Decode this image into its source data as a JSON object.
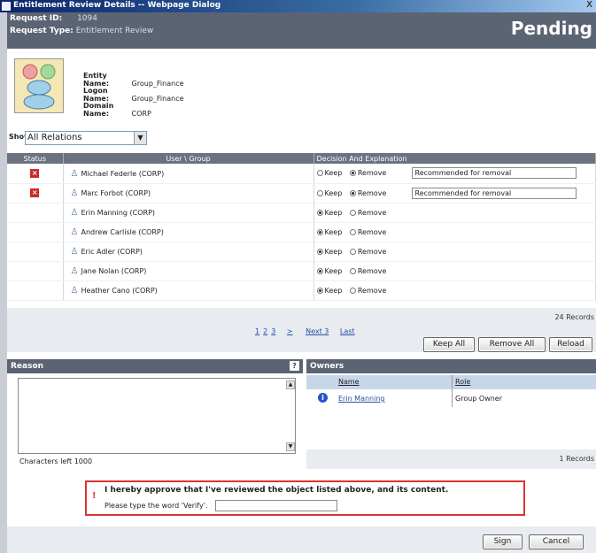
{
  "window": {
    "title": "Entitlement Review Details -- Webpage Dialog",
    "close": "X"
  },
  "header": {
    "request_id_label": "Request ID:",
    "request_id": "1094",
    "request_type_label": "Request Type:",
    "request_type": "Entitlement Review",
    "status": "Pending"
  },
  "entity": {
    "entity_name_label": "Entity Name:",
    "entity_name": "Group_Finance",
    "logon_name_label": "Logon Name:",
    "logon_name": "Group_Finance",
    "domain_name_label": "Domain Name:",
    "domain_name": "CORP"
  },
  "show": {
    "label": "Show:",
    "value": "All Relations"
  },
  "grid": {
    "columns": [
      "Status",
      "User \\ Group",
      "Decision And Explanation"
    ],
    "keep_label": "Keep",
    "remove_label": "Remove",
    "rows": [
      {
        "user": "Michael Federle (CORP)",
        "removed": true,
        "explanation": "Recommended for removal"
      },
      {
        "user": "Marc Forbot (CORP)",
        "removed": true,
        "explanation": "Recommended for removal"
      },
      {
        "user": "Erin Manning (CORP)",
        "removed": false,
        "explanation": ""
      },
      {
        "user": "Andrew Carlisle (CORP)",
        "removed": false,
        "explanation": ""
      },
      {
        "user": "Eric Adler (CORP)",
        "removed": false,
        "explanation": ""
      },
      {
        "user": "Jane Nolan (CORP)",
        "removed": false,
        "explanation": ""
      },
      {
        "user": "Heather Cano (CORP)",
        "removed": false,
        "explanation": ""
      }
    ],
    "records": "24 Records",
    "pager": {
      "p1": "1",
      "p2": "2",
      "p3": "3",
      "gt": ">",
      "next": "Next 3",
      "last": "Last"
    }
  },
  "buttons": {
    "keep_all": "Keep All",
    "remove_all": "Remove All",
    "reload": "Reload",
    "sign": "Sign",
    "cancel": "Cancel"
  },
  "reason": {
    "title": "Reason",
    "help": "?",
    "chars_left": "Characters left 1000"
  },
  "owners": {
    "title": "Owners",
    "col_name": "Name",
    "col_role": "Role",
    "rows": [
      {
        "name": "Erin Manning",
        "role": "Group Owner"
      }
    ],
    "records": "1 Records"
  },
  "approve": {
    "bang": "!",
    "statement": "I hereby approve that I've reviewed the object listed above, and its content.",
    "instruction": "Please type the word 'Verify'."
  }
}
